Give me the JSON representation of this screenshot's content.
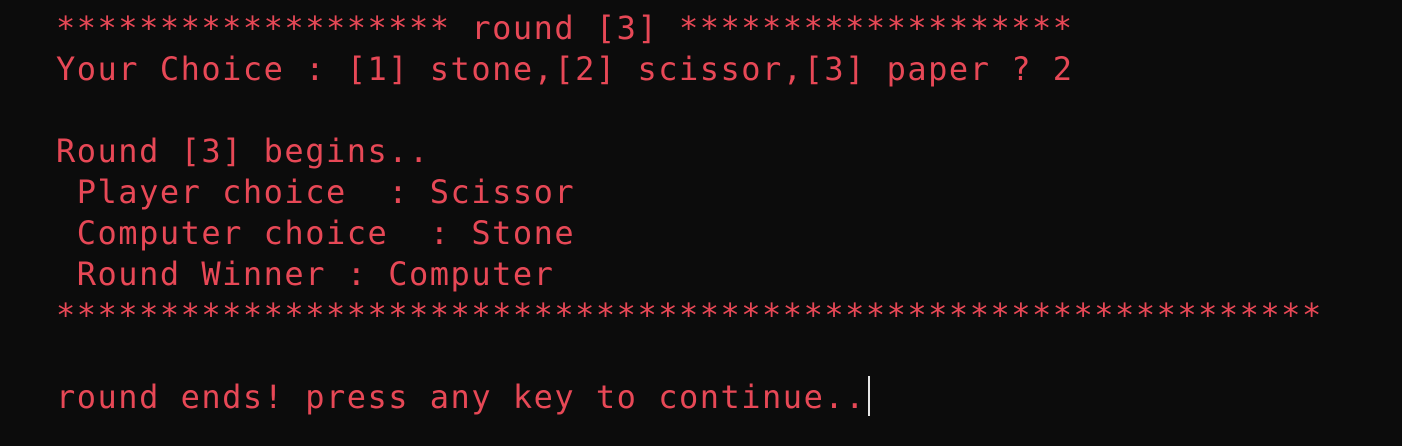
{
  "theme": {
    "background": "#0c0c0c",
    "text_color": "#e74856",
    "cursor_color": "#e6e6e6"
  },
  "terminal": {
    "lines": [
      "******************* round [3] *******************",
      "Your Choice : [1] stone,[2] scissor,[3] paper ? 2",
      "",
      "Round [3] begins..",
      " Player choice  : Scissor",
      " Computer choice  : Stone",
      " Round Winner : Computer",
      "*************************************************************",
      "",
      "round ends! press any key to continue.."
    ]
  }
}
